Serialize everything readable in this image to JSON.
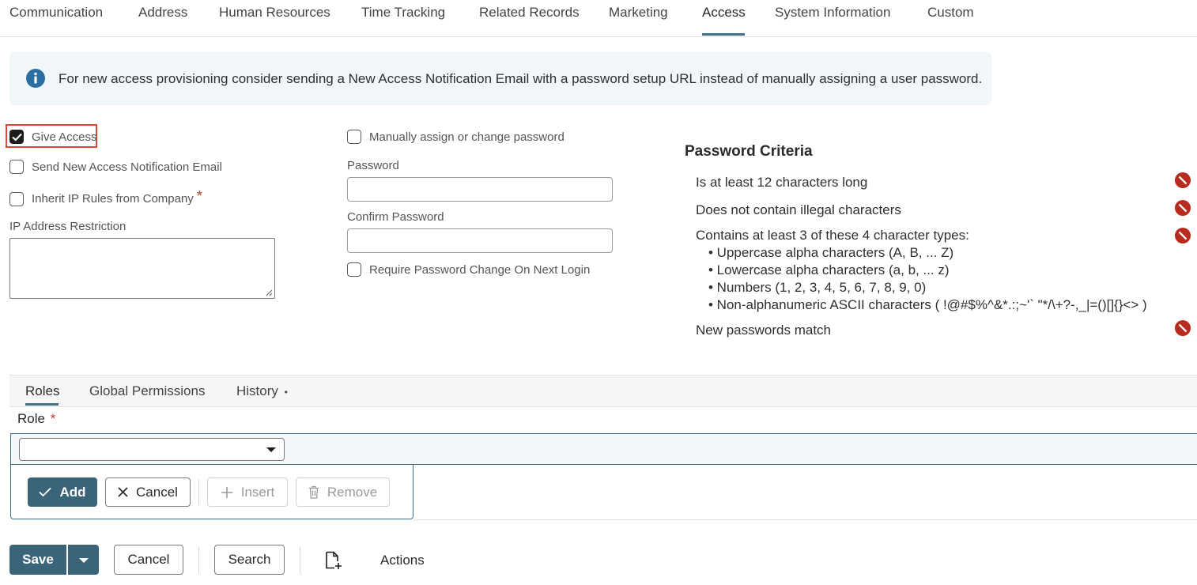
{
  "top_tabs": [
    {
      "label": "Communication"
    },
    {
      "label": "Address"
    },
    {
      "label": "Human Resources"
    },
    {
      "label": "Time Tracking"
    },
    {
      "label": "Related Records"
    },
    {
      "label": "Marketing"
    },
    {
      "label": "Access"
    },
    {
      "label": "System Information"
    },
    {
      "label": "Custom"
    }
  ],
  "active_tab": "Access",
  "banner": {
    "icon": "info-icon",
    "text": "For new access provisioning consider sending a New Access Notification Email with a password setup URL instead of manually assigning a user password."
  },
  "left_column": {
    "give_access": {
      "label": "Give Access",
      "checked": true
    },
    "send_notification": {
      "label": "Send New Access Notification Email",
      "checked": false
    },
    "inherit_ip": {
      "label": "Inherit IP Rules from Company",
      "checked": false,
      "required_mark": "*"
    },
    "ip_restriction": {
      "label": "IP Address Restriction",
      "value": ""
    }
  },
  "middle_column": {
    "manual_password": {
      "label": "Manually assign or change password",
      "checked": false
    },
    "password": {
      "label": "Password",
      "value": ""
    },
    "confirm_password": {
      "label": "Confirm Password",
      "value": ""
    },
    "require_change": {
      "label": "Require Password Change On Next Login",
      "checked": false
    }
  },
  "password_criteria": {
    "title": "Password Criteria",
    "items": [
      {
        "text": "Is at least 12 characters long",
        "status": "not-met"
      },
      {
        "text": "Does not contain illegal characters",
        "status": "not-met"
      },
      {
        "text": "Contains at least 3 of these 4 character types:",
        "status": "not-met"
      },
      {
        "text": "New passwords match",
        "status": "not-met"
      }
    ],
    "sub_items": [
      "• Uppercase alpha characters (A, B, ... Z)",
      "• Lowercase alpha characters (a, b, ... z)",
      "• Numbers (1, 2, 3, 4, 5, 6, 7, 8, 9, 0)",
      "• Non-alphanumeric ASCII characters ( !@#$%^&*.:;~'` \"*/\\+?-,_|=()[]{}<> )"
    ]
  },
  "sublist": {
    "tabs": [
      {
        "label": "Roles"
      },
      {
        "label": "Global Permissions"
      },
      {
        "label": "History",
        "dot": "•"
      }
    ],
    "active_tab": "Roles",
    "role_label": "Role",
    "role_required": "*",
    "role_value": "",
    "buttons": {
      "add": "Add",
      "cancel": "Cancel",
      "insert": "Insert",
      "remove": "Remove"
    }
  },
  "footer": {
    "save": "Save",
    "cancel": "Cancel",
    "search": "Search",
    "actions": "Actions"
  },
  "colors": {
    "accent": "#3a6479",
    "error": "#b8291e",
    "banner_bg": "#f1f6f9",
    "highlight": "#e0443a"
  }
}
